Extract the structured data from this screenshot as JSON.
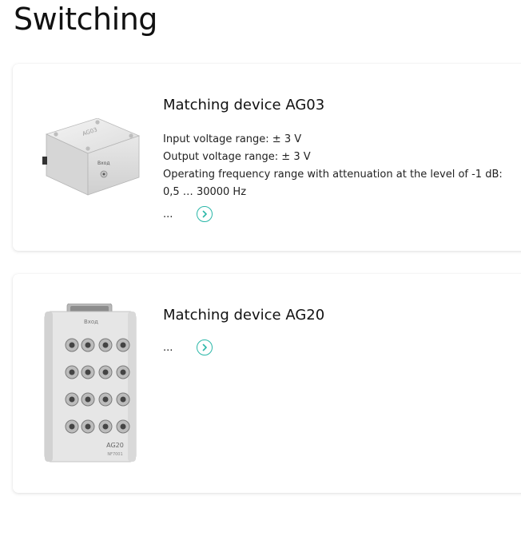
{
  "page": {
    "title": "Switching"
  },
  "products": [
    {
      "title": "Matching device AG03",
      "specs": [
        "Input voltage range: ± 3 V",
        "Output voltage range: ± 3 V",
        "Operating frequency range with attenuation at the level of -1 dB:",
        "0,5 … 30000 Hz"
      ],
      "more_text": "...",
      "image_icon": "junction-box-image"
    },
    {
      "title": "Matching device AG20",
      "specs": [],
      "more_text": "...",
      "image_icon": "bnc-panel-device-image"
    }
  ],
  "colors": {
    "accent": "#2bb7a8",
    "text": "#1a1a1a"
  },
  "more_icon": "chevron-right-circle-icon"
}
